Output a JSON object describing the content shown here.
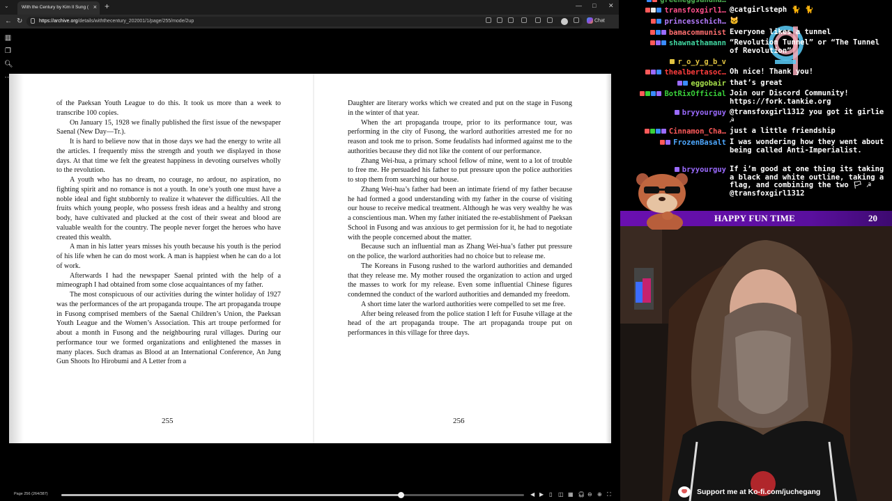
{
  "browser": {
    "tab_title": "With the Century by Kim Il Sung (",
    "tab_close": "×",
    "new_tab": "+",
    "url_host": "https://archive.org",
    "url_path": "/details/withthecentury_202001/1/page/255/mode/2up",
    "copilot_label": "Chat",
    "minimize": "—",
    "maximize": "□",
    "close": "✕"
  },
  "reader": {
    "page_label": "Page 256 (264/387)",
    "progress_fraction": 0.734,
    "left_page": {
      "number": "255",
      "paragraphs": [
        "of the Paeksan Youth League to do this. It took us more than a week to transcribe 100 copies.",
        "On January 15, 1928 we finally published the first issue of the newspaper Saenal (New Day—Tr.).",
        "It is hard to believe now that in those days we had the energy to write all the articles. I frequently miss the strength and youth we displayed in those days. At that time we felt the greatest happiness in devoting ourselves wholly to the revolution.",
        "A youth who has no dream, no courage, no ardour, no aspiration, no fighting spirit and no romance is not a youth. In one’s youth one must have a noble ideal and fight stubbornly to realize it whatever the difficulties. All the fruits which young people, who possess fresh ideas and a healthy and strong body, have cultivated and plucked at the cost of their sweat and blood are valuable wealth for the country. The people never forget the heroes who have created this wealth.",
        "A man in his latter years misses his youth because his youth is the period of his life when he can do most work. A man is happiest when he can do a lot of work.",
        "Afterwards I had the newspaper Saenal printed with the help of a mimeograph I had obtained from some close acquaintances of my father.",
        "The most conspicuous of our activities during the winter holiday of 1927 was the performances of the art propaganda troupe. The art propaganda troupe in Fusong comprised members of the Saenal Children’s Union, the Paeksan Youth League and the Women’s Association. This art troupe performed for about a month in Fusong and the neighbouring rural villages. During our performance tour we formed organizations and enlightened the masses in many places. Such dramas as Blood at an International Conference, An Jung Gun Shoots Ito Hirobumi and A Letter from a"
      ]
    },
    "right_page": {
      "number": "256",
      "paragraphs": [
        "Daughter are literary works which we created and put on the stage in Fusong in the winter of that year.",
        "When the art propaganda troupe, prior to its performance tour, was performing in the city of Fusong, the warlord authorities arrested me for no reason and took me to prison. Some feudalists had informed against me to the authorities because they did not like the content of our performance.",
        "Zhang Wei-hua, a primary school fellow of mine, went to a lot of trouble to free me. He persuaded his father to put pressure upon the police authorities to stop them from searching our house.",
        "Zhang Wei-hua’s father had been an intimate friend of my father because he had formed a good understanding with my father in the course of visiting our house to receive medical treatment. Although he was very wealthy he was a conscientious man. When my father initiated the re-establishment of Paeksan School in Fusong and was anxious to get permission for it, he had to negotiate with the people concerned about the matter.",
        "Because such an influential man as Zhang Wei-hua’s father put pressure on the police, the warlord authorities had no choice but to release me.",
        "The Koreans in Fusong rushed to the warlord authorities and demanded that they release me. My mother roused the organization to action and urged the masses to work for my release. Even some influential Chinese figures condemned the conduct of the warlord authorities and demanded my freedom.",
        "A short time later the warlord authorities were compelled to set me free.",
        "After being released from the police station I left for Fusuhe village at the head of the art propaganda troupe. The art propaganda troupe put on performances in this village for three days."
      ]
    }
  },
  "chat": {
    "messages": [
      {
        "user": "greeneggsandha…",
        "color": "#4caf50",
        "text": ""
      },
      {
        "user": "transfoxgirl1…",
        "color": "#ff4f8a",
        "text": "@catgirlsteph 🐈 🐈"
      },
      {
        "user": "princesschich…",
        "color": "#b57cff",
        "text": "🐱"
      },
      {
        "user": "bamacommunist",
        "color": "#ff6f6f",
        "text": "Everyone likes a tunnel"
      },
      {
        "user": "shawnathamann",
        "color": "#41d6a0",
        "text": "“Revolution Tunnel” or “The Tunnel of Revolution”"
      },
      {
        "user": "r_o_y_g_b_v",
        "color": "#e0c341",
        "text": ""
      },
      {
        "user": "thealbertasoc…",
        "color": "#ff3d3d",
        "text": "Oh nice! Thank you!"
      },
      {
        "user": "eggobair",
        "color": "#a7e04a",
        "text": "that’s great"
      },
      {
        "user": "BotRixOfficial",
        "color": "#3ad13a",
        "text": "Join our Discord Community! https://fork.tankie.org"
      },
      {
        "user": "bryyourguy",
        "color": "#9b6bff",
        "text": "@transfoxgirl1312 you got it girlie ☭"
      },
      {
        "user": "Cinnamon_Cha…",
        "color": "#ff5a5a",
        "text": "just a little friendship"
      },
      {
        "user": "FrozenBasalt",
        "color": "#4ea8ff",
        "text": "I was wondering how they went about being called Anti-Imperialist."
      },
      {
        "user": "bryyourguy",
        "color": "#9b6bff",
        "text": "If i’m good at one thing its taking a black and white outline, taking a flag, and combining the two 🏳 ☭ @transfoxgirl1312"
      }
    ]
  },
  "overlay": {
    "banner_title": "HAPPY FUN TIME",
    "banner_count": "20",
    "kofi_text": "Support me at Ko-fi.com/juchegang"
  }
}
